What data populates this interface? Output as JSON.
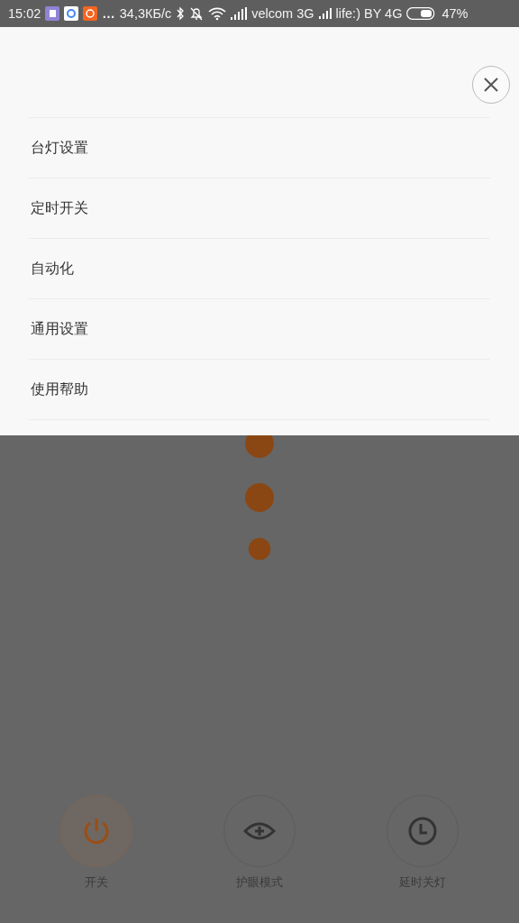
{
  "status_bar": {
    "time": "15:02",
    "more": "…",
    "speed": "34,3КБ/с",
    "carrier_1": "velcom 3G",
    "carrier_2": "life:) BY 4G",
    "battery": "47%"
  },
  "menu": {
    "items": [
      {
        "label": "台灯设置"
      },
      {
        "label": "定时开关"
      },
      {
        "label": "自动化"
      },
      {
        "label": "通用设置"
      },
      {
        "label": "使用帮助"
      }
    ]
  },
  "controls": [
    {
      "kind": "power",
      "label": "开关",
      "active": true
    },
    {
      "kind": "eye",
      "label": "护眼模式",
      "active": false
    },
    {
      "kind": "timer",
      "label": "延时关灯",
      "active": false
    }
  ]
}
